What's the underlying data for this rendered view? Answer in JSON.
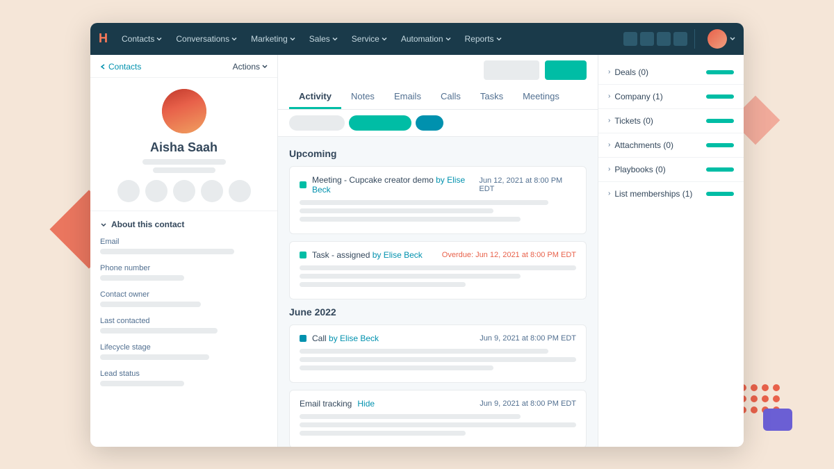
{
  "nav": {
    "logo": "H",
    "items": [
      {
        "label": "Contacts",
        "id": "contacts"
      },
      {
        "label": "Conversations",
        "id": "conversations"
      },
      {
        "label": "Marketing",
        "id": "marketing"
      },
      {
        "label": "Sales",
        "id": "sales"
      },
      {
        "label": "Service",
        "id": "service"
      },
      {
        "label": "Automation",
        "id": "automation"
      },
      {
        "label": "Reports",
        "id": "reports"
      }
    ]
  },
  "breadcrumb": {
    "back_label": "Contacts",
    "actions_label": "Actions"
  },
  "profile": {
    "name": "Aisha Saah"
  },
  "about": {
    "toggle_label": "About this contact",
    "fields": [
      {
        "label": "Email"
      },
      {
        "label": "Phone number"
      },
      {
        "label": "Contact owner"
      },
      {
        "label": "Last contacted"
      },
      {
        "label": "Lifecycle stage"
      },
      {
        "label": "Lead status"
      }
    ]
  },
  "tabs": {
    "items": [
      {
        "label": "Activity",
        "active": true
      },
      {
        "label": "Notes"
      },
      {
        "label": "Emails"
      },
      {
        "label": "Calls"
      },
      {
        "label": "Tasks"
      },
      {
        "label": "Meetings"
      }
    ]
  },
  "feed": {
    "sections": [
      {
        "title": "Upcoming",
        "cards": [
          {
            "type": "Meeting",
            "dot_color": "green",
            "text": "Meeting - Cupcake creator demo",
            "by": "by Elise Beck",
            "date": "Jun 12, 2021 at 8:00 PM EDT",
            "overdue": false
          },
          {
            "type": "Task",
            "dot_color": "green",
            "text": "Task - assigned",
            "by": "by Elise Beck",
            "date": "Overdue: Jun 12, 2021 at 8:00 PM EDT",
            "overdue": true
          }
        ]
      },
      {
        "title": "June 2022",
        "cards": [
          {
            "type": "Call",
            "dot_color": "blue",
            "text": "Call",
            "by": "by Elise Beck",
            "date": "Jun 9, 2021 at 8:00 PM EDT",
            "overdue": false
          },
          {
            "type": "EmailTracking",
            "dot_color": "none",
            "text": "Email tracking",
            "hide_label": "Hide",
            "date": "Jun 9, 2021 at 8:00 PM EDT",
            "overdue": false
          }
        ]
      }
    ]
  },
  "right_panel": {
    "items": [
      {
        "label": "Deals (0)"
      },
      {
        "label": "Company (1)"
      },
      {
        "label": "Tickets (0)"
      },
      {
        "label": "Attachments (0)"
      },
      {
        "label": "Playbooks (0)"
      },
      {
        "label": "List memberships (1)"
      }
    ]
  }
}
